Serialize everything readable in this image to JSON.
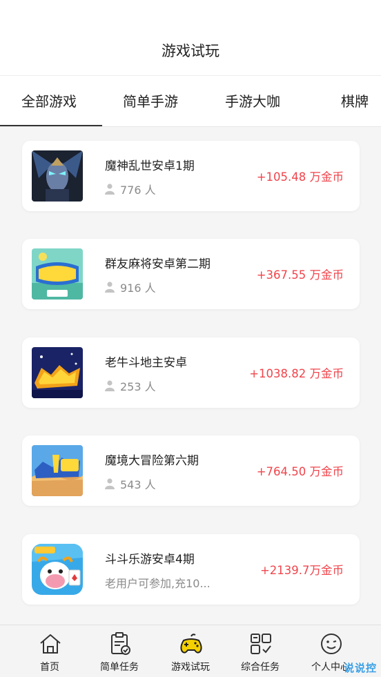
{
  "header": {
    "title": "游戏试玩"
  },
  "tabs": [
    {
      "label": "全部游戏",
      "active": true
    },
    {
      "label": "简单手游",
      "active": false
    },
    {
      "label": "手游大咖",
      "active": false
    },
    {
      "label": "棋牌",
      "active": false
    }
  ],
  "games": [
    {
      "name": "魔神乱世安卓1期",
      "players": "776 人",
      "reward": "+105.48 万金币"
    },
    {
      "name": "群友麻将安卓第二期",
      "players": "916 人",
      "reward": "+367.55 万金币"
    },
    {
      "name": "老牛斗地主安卓",
      "players": "253 人",
      "reward": "+1038.82 万金币"
    },
    {
      "name": "魔境大冒险第六期",
      "players": "543 人",
      "reward": "+764.50 万金币"
    },
    {
      "name": "斗斗乐游安卓4期",
      "note": "老用户可参加,充10...",
      "reward": "+2139.7万金币"
    }
  ],
  "tabbar": [
    {
      "label": "首页",
      "icon": "home-icon"
    },
    {
      "label": "简单任务",
      "icon": "clipboard-check-icon"
    },
    {
      "label": "游戏试玩",
      "icon": "gamepad-icon",
      "active": true
    },
    {
      "label": "综合任务",
      "icon": "grid-check-icon"
    },
    {
      "label": "个人中心",
      "icon": "smiley-icon"
    }
  ],
  "watermark": "说说控",
  "colors": {
    "reward": "#f0444b",
    "active_gamepad": "#f5d000",
    "text_gray": "#8a8a8a"
  }
}
